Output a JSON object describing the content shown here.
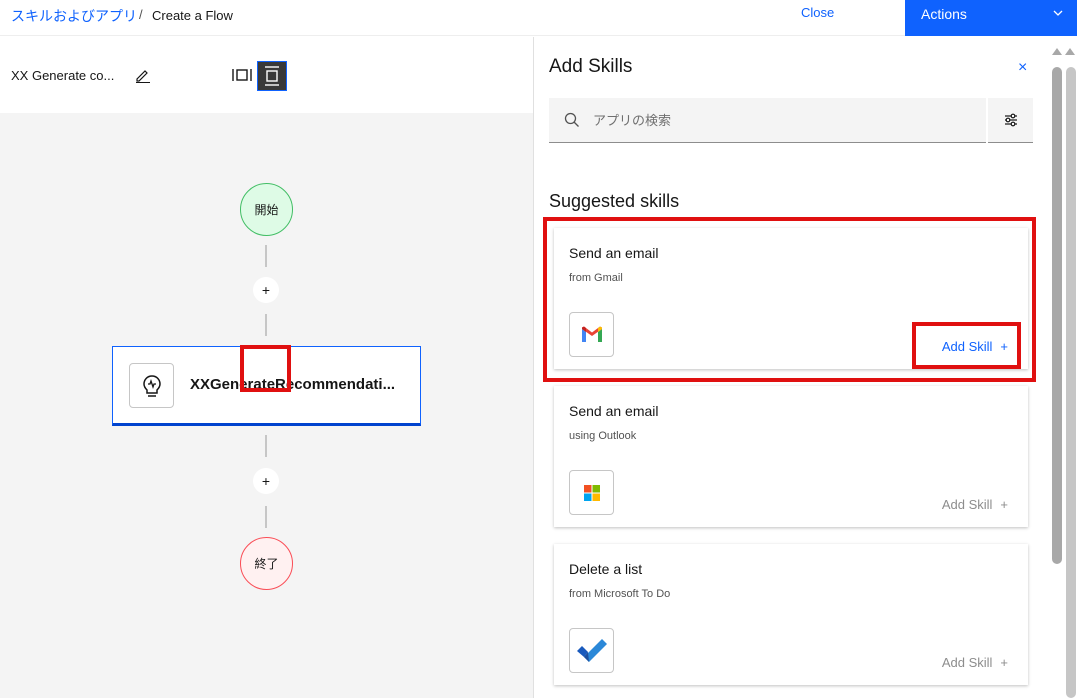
{
  "breadcrumb": {
    "root": "スキルおよびアプリ",
    "separator": "/",
    "current": "Create a Flow"
  },
  "header": {
    "close_label": "Close",
    "actions_label": "Actions"
  },
  "flow": {
    "name": "XX Generate co..."
  },
  "canvas": {
    "start_label": "開始",
    "end_label": "終了",
    "skill_node_name": "XXGenerateRecommendati...",
    "add_step_symbol": "+"
  },
  "panel": {
    "title": "Add Skills",
    "close_symbol": "×",
    "search_placeholder": "アプリの検索",
    "section_title": "Suggested skills",
    "cards": [
      {
        "title": "Send an email",
        "subtitle": "from Gmail",
        "add_label": "Add Skill",
        "plus": "+",
        "logo": "gmail-icon",
        "active": true
      },
      {
        "title": "Send an email",
        "subtitle": "using Outlook",
        "add_label": "Add Skill",
        "plus": "+",
        "logo": "microsoft-icon",
        "active": false
      },
      {
        "title": "Delete a list",
        "subtitle": "from Microsoft To Do",
        "add_label": "Add Skill",
        "plus": "+",
        "logo": "microsoft-todo-icon",
        "active": false
      }
    ]
  },
  "colors": {
    "accent": "#0f62fe",
    "highlight": "#e01010",
    "start": "#42be65",
    "end": "#fa4d56"
  }
}
